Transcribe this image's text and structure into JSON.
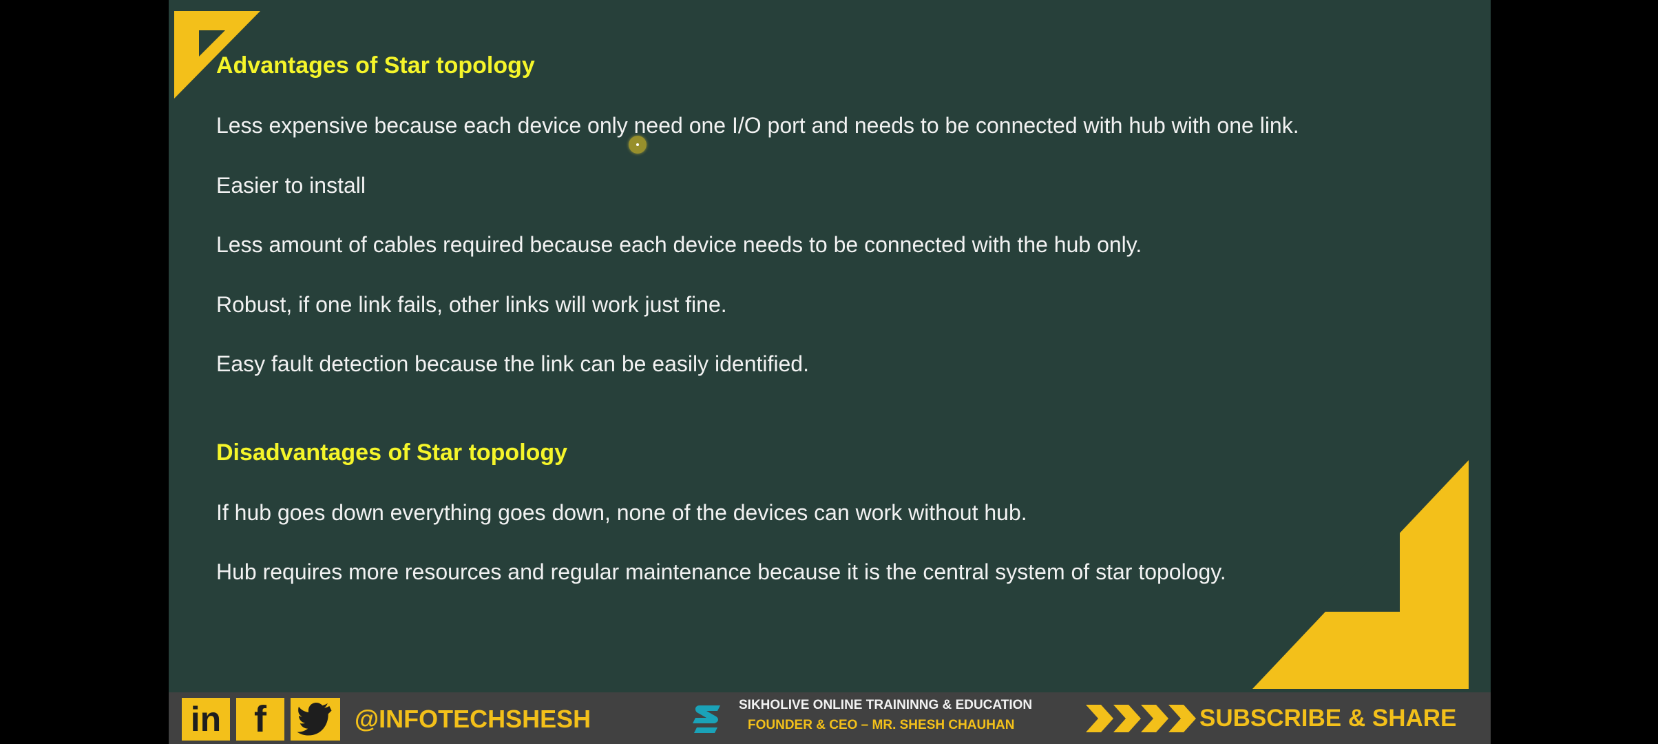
{
  "slide": {
    "advantages_heading": "Advantages of Star topology",
    "advantages": [
      "Less expensive because each device only need one I/O port and needs to be connected with hub with one link.",
      "Easier to install",
      "Less amount of cables required because each device needs to be connected with the hub only.",
      "Robust, if one link fails, other links will work just fine.",
      "Easy fault detection because the link can be easily identified."
    ],
    "disadvantages_heading": "Disadvantages of Star topology",
    "disadvantages": [
      "If hub goes down everything goes down, none of the devices can work without hub.",
      "Hub requires more resources and regular maintenance because it is the central system of star topology."
    ]
  },
  "footer": {
    "linkedin_icon_text": "in",
    "facebook_icon_text": "f",
    "handle": "@INFOTECHSHESH",
    "org_name": "SIKHOLIVE ONLINE TRAININNG & EDUCATION",
    "founder": "FOUNDER & CEO – MR. SHESH CHAUHAN",
    "cta": "SUBSCRIBE & SHARE"
  },
  "colors": {
    "background": "#27403a",
    "heading": "#f5f52a",
    "accent": "#f3c01a",
    "text": "#f2f2f2",
    "footer": "#414141"
  },
  "icons": [
    "linkedin-icon",
    "facebook-icon",
    "twitter-icon",
    "sikholive-logo-icon",
    "chevron-arrows-icon"
  ]
}
